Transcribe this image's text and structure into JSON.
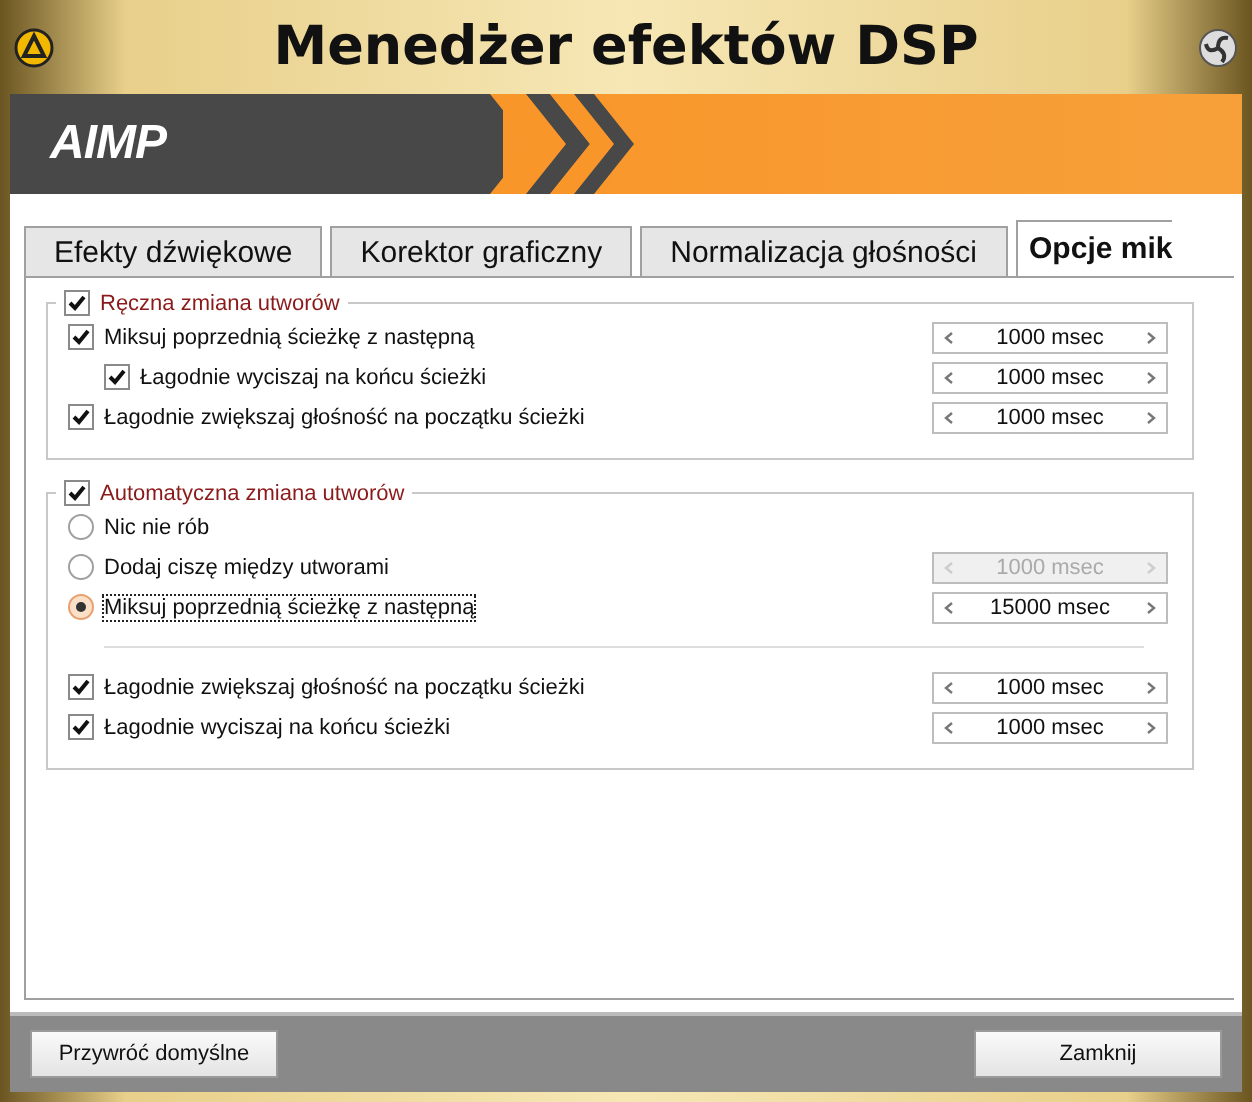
{
  "window": {
    "title": "Menedżer efektów DSP"
  },
  "banner": {
    "brand": "AIMP"
  },
  "tabs": [
    {
      "label": "Efekty dźwiękowe",
      "selected": false
    },
    {
      "label": "Korektor graficzny",
      "selected": false
    },
    {
      "label": "Normalizacja głośności",
      "selected": false
    },
    {
      "label": "Opcje mik",
      "selected": true
    }
  ],
  "groups": [
    {
      "label": "Ręczna zmiana utworów",
      "checked": true,
      "rows": [
        {
          "kind": "checkbox",
          "label": "Miksuj poprzednią ścieżkę z następną",
          "checked": true,
          "indented": false,
          "spinner": {
            "value": "1000 msec",
            "disabled": false
          }
        },
        {
          "kind": "checkbox",
          "label": "Łagodnie wyciszaj na końcu ścieżki",
          "checked": true,
          "indented": true,
          "spinner": {
            "value": "1000 msec",
            "disabled": false
          }
        },
        {
          "kind": "checkbox",
          "label": "Łagodnie zwiększaj głośność na początku ścieżki",
          "checked": true,
          "indented": false,
          "spinner": {
            "value": "1000 msec",
            "disabled": false
          }
        }
      ]
    },
    {
      "label": "Automatyczna zmiana utworów",
      "checked": true,
      "rows": [
        {
          "kind": "radio",
          "label": "Nic nie rób",
          "selected": false
        },
        {
          "kind": "radio",
          "label": "Dodaj ciszę między utworami",
          "selected": false,
          "spinner": {
            "value": "1000 msec",
            "disabled": true
          }
        },
        {
          "kind": "radio",
          "label": "Miksuj poprzednią ścieżkę z następną",
          "selected": true,
          "spinner": {
            "value": "15000 msec",
            "disabled": false
          }
        },
        {
          "kind": "separator"
        },
        {
          "kind": "checkbox",
          "label": "Łagodnie zwiększaj głośność na początku ścieżki",
          "checked": true,
          "indented": false,
          "spinner": {
            "value": "1000 msec",
            "disabled": false
          }
        },
        {
          "kind": "checkbox",
          "label": "Łagodnie wyciszaj na końcu ścieżki",
          "checked": true,
          "indented": false,
          "spinner": {
            "value": "1000 msec",
            "disabled": false
          }
        }
      ]
    }
  ],
  "footer": {
    "buttons": [
      {
        "label": "Przywróć domyślne"
      },
      {
        "label": "Zamknij"
      }
    ]
  }
}
